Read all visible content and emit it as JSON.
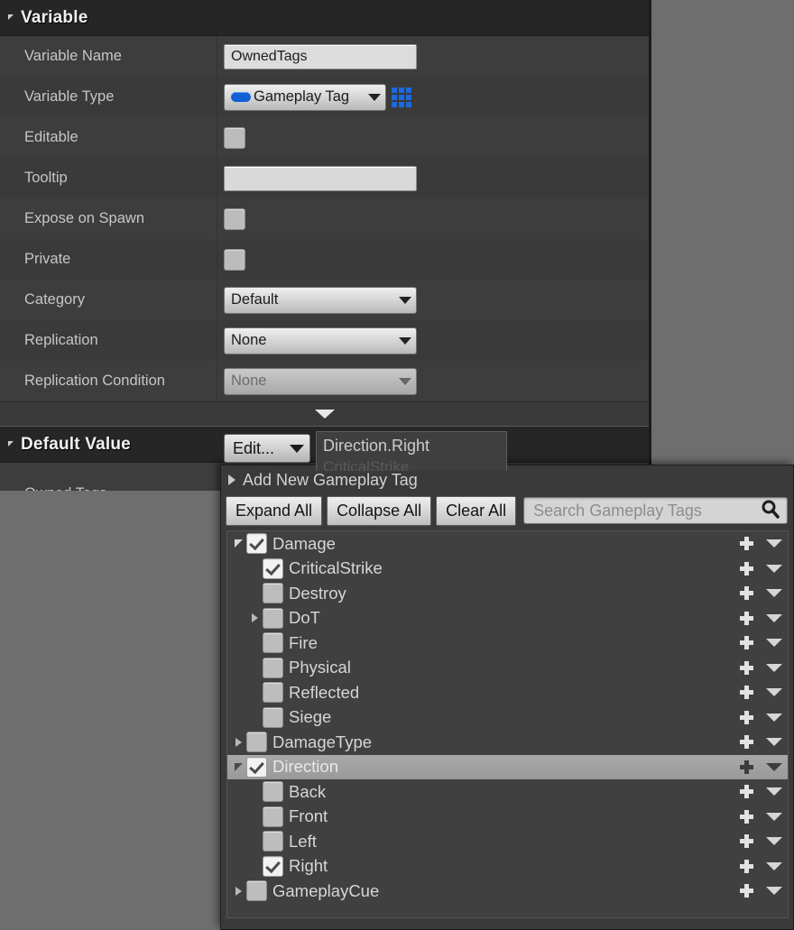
{
  "details_panel": {
    "variable_section": {
      "title": "Variable",
      "rows": [
        {
          "label": "Variable Name",
          "type": "text",
          "value": "OwnedTags"
        },
        {
          "label": "Variable Type",
          "type": "typecombo",
          "value": "Gameplay Tag",
          "icon": "gameplay-tag-pill-icon",
          "grid_icon": "container-grid-icon"
        },
        {
          "label": "Editable",
          "type": "checkbox",
          "checked": false
        },
        {
          "label": "Tooltip",
          "type": "text",
          "value": ""
        },
        {
          "label": "Expose on Spawn",
          "type": "checkbox",
          "checked": false
        },
        {
          "label": "Private",
          "type": "checkbox",
          "checked": false
        },
        {
          "label": "Category",
          "type": "combo",
          "value": "Default",
          "disabled": false
        },
        {
          "label": "Replication",
          "type": "combo",
          "value": "None",
          "disabled": false
        },
        {
          "label": "Replication Condition",
          "type": "combo",
          "value": "None",
          "disabled": true
        }
      ]
    },
    "default_value_section": {
      "title": "Default Value",
      "owned_tags_label": "Owned Tags",
      "edit_button_label": "Edit...",
      "tag_summary_line1": "Direction.Right",
      "tag_summary_line2": "CriticalStrike"
    }
  },
  "tag_popup": {
    "add_new_label": "Add New Gameplay Tag",
    "toolbar": {
      "expand_all": "Expand All",
      "collapse_all": "Collapse All",
      "clear_all": "Clear All",
      "search_placeholder": "Search Gameplay Tags",
      "search_value": ""
    },
    "tree": [
      {
        "label": "Damage",
        "depth": 0,
        "checked": true,
        "twisty": "down",
        "selected": false
      },
      {
        "label": "CriticalStrike",
        "depth": 1,
        "checked": true,
        "twisty": "none",
        "selected": false
      },
      {
        "label": "Destroy",
        "depth": 1,
        "checked": false,
        "twisty": "none",
        "selected": false
      },
      {
        "label": "DoT",
        "depth": 1,
        "checked": false,
        "twisty": "right",
        "selected": false
      },
      {
        "label": "Fire",
        "depth": 1,
        "checked": false,
        "twisty": "none",
        "selected": false
      },
      {
        "label": "Physical",
        "depth": 1,
        "checked": false,
        "twisty": "none",
        "selected": false
      },
      {
        "label": "Reflected",
        "depth": 1,
        "checked": false,
        "twisty": "none",
        "selected": false
      },
      {
        "label": "Siege",
        "depth": 1,
        "checked": false,
        "twisty": "none",
        "selected": false
      },
      {
        "label": "DamageType",
        "depth": 0,
        "checked": false,
        "twisty": "right",
        "selected": false
      },
      {
        "label": "Direction",
        "depth": 0,
        "checked": true,
        "twisty": "down",
        "selected": true
      },
      {
        "label": "Back",
        "depth": 1,
        "checked": false,
        "twisty": "none",
        "selected": false
      },
      {
        "label": "Front",
        "depth": 1,
        "checked": false,
        "twisty": "none",
        "selected": false
      },
      {
        "label": "Left",
        "depth": 1,
        "checked": false,
        "twisty": "none",
        "selected": false
      },
      {
        "label": "Right",
        "depth": 1,
        "checked": true,
        "twisty": "none",
        "selected": false
      },
      {
        "label": "GameplayCue",
        "depth": 0,
        "checked": false,
        "twisty": "right",
        "selected": false
      }
    ],
    "row_action_add_icon": "plus-icon",
    "row_action_menu_icon": "chevron-down-icon"
  },
  "colors": {
    "panel_bg": "#3d3d3d",
    "header_bg": "#262626",
    "popup_bg": "#3a3a3a",
    "accent_blue": "#1a6ae0",
    "selection": "#a8a8a8",
    "backdrop": "#6e6e6e"
  }
}
